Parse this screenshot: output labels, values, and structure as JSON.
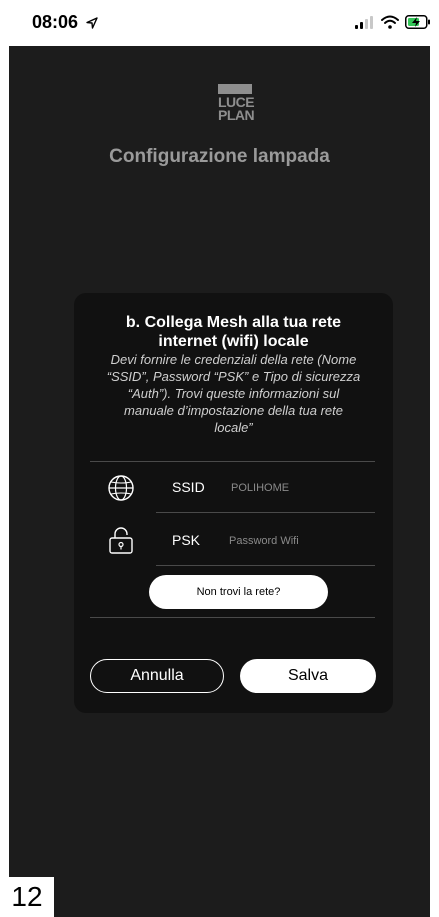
{
  "status_bar": {
    "time": "08:06",
    "icons": [
      "location-arrow-icon",
      "signal-icon",
      "wifi-icon",
      "battery-charging-icon"
    ]
  },
  "header": {
    "logo_line1": "LUCE",
    "logo_line2": "PLAN",
    "title": "Configurazione lampada"
  },
  "dialog": {
    "heading_line1": "b. Collega Mesh alla tua rete",
    "heading_line2": "internet (wifi) locale",
    "description_line1": "Devi fornire le credenziali della rete (Nome",
    "description_line2": "“SSID”, Password “PSK” e Tipo di sicurezza",
    "description_line3": "“Auth”). Trovi queste informazioni sul",
    "description_line4": "manuale d’impostazione della tua rete",
    "description_line5": "locale”",
    "ssid": {
      "label": "SSID",
      "placeholder": "POLIHOME",
      "icon": "globe-icon"
    },
    "psk": {
      "label": "PSK",
      "placeholder": "Password Wifi",
      "icon": "lock-icon"
    },
    "help_label": "Non trovi la rete?",
    "cancel_label": "Annulla",
    "save_label": "Salva"
  },
  "page_number": "12"
}
